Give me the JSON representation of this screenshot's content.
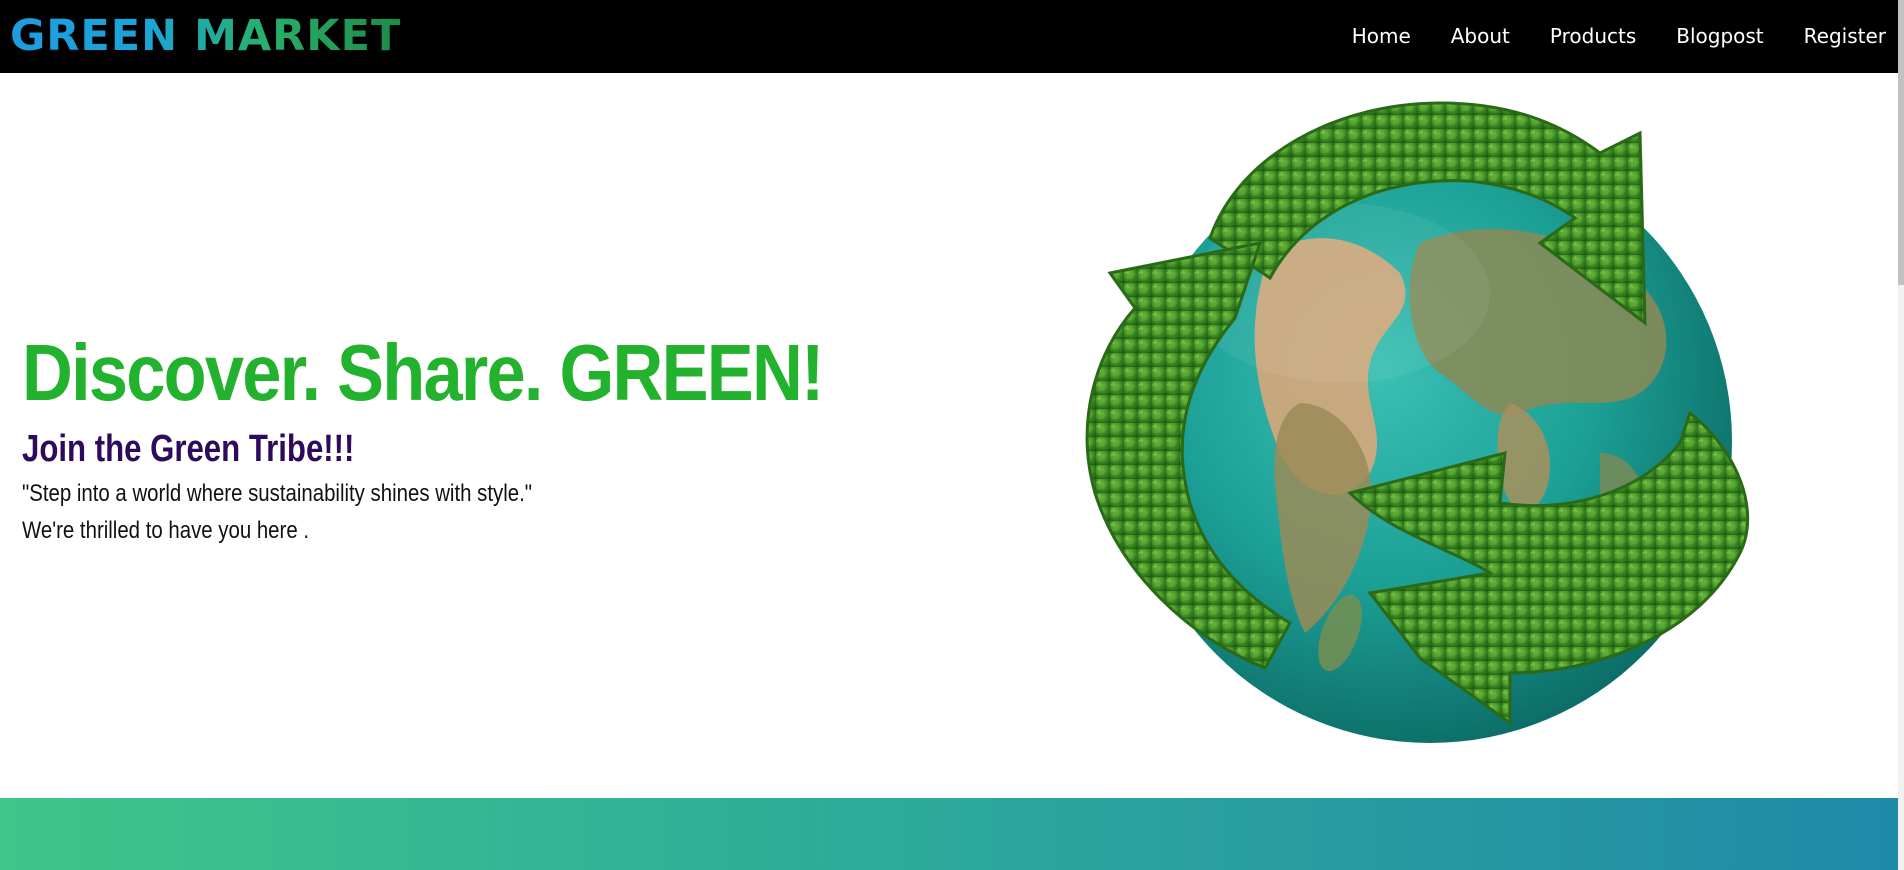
{
  "brand": {
    "logo_text": "GREEN MARKET"
  },
  "nav": {
    "items": [
      {
        "label": "Home"
      },
      {
        "label": "About"
      },
      {
        "label": "Products"
      },
      {
        "label": "Blogpost"
      },
      {
        "label": "Register"
      }
    ]
  },
  "hero": {
    "heading": "Discover. Share. GREEN!",
    "subheading": "Join the Green Tribe!!!",
    "quote": "\"Step into a world where sustainability shines with style.\"",
    "welcome": "We're thrilled to have you here ."
  },
  "illustration": {
    "icon": "globe-recycle-icon"
  },
  "colors": {
    "nav_bg": "#000000",
    "heading": "#23b22d",
    "subheading": "#2e0a5c",
    "band_start": "#3fc58a",
    "band_end": "#1f8aa8"
  }
}
